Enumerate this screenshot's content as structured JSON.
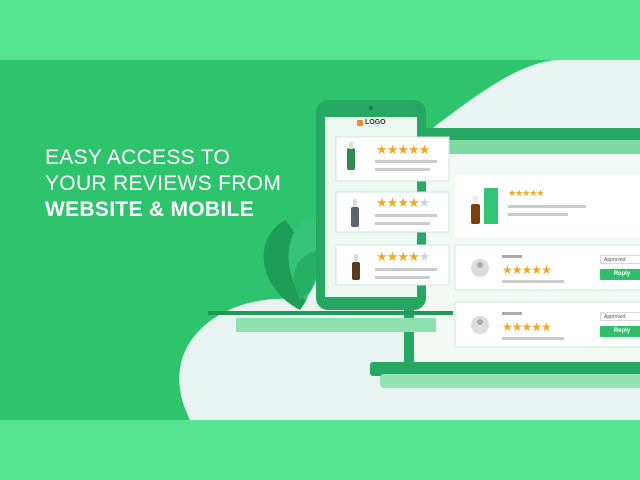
{
  "headline": {
    "line1": "EASY ACCESS TO",
    "line2": "YOUR REVIEWS FROM",
    "line3": "WEBSITE & MOBILE"
  },
  "phone": {
    "logo_text": "LOGO",
    "reviews": [
      {
        "rating": 5
      },
      {
        "rating": 4
      },
      {
        "rating": 4
      }
    ]
  },
  "website": {
    "product_rating": 5,
    "reviews": [
      {
        "rating": 5,
        "status": "Approved",
        "reply_label": "Reply"
      },
      {
        "rating": 5,
        "status": "Approved",
        "reply_label": "Reply"
      }
    ]
  },
  "colors": {
    "background": "#55e492",
    "brand_green": "#2cc46a",
    "dark_green": "#1f9a57",
    "star": "#f5a623"
  }
}
